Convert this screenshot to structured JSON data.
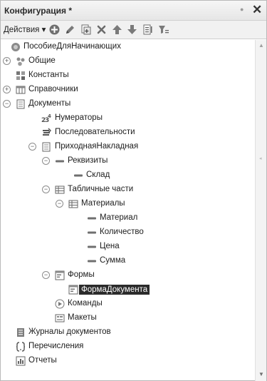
{
  "window": {
    "title": "Конфигурация *"
  },
  "toolbar": {
    "actions_label": "Действия ▾"
  },
  "tree": [
    {
      "id": "root",
      "label": "ПособиеДляНачинающих",
      "icon": "config-root-icon",
      "expander": ""
    },
    {
      "id": "common",
      "label": "Общие",
      "icon": "common-icon",
      "expander": "+"
    },
    {
      "id": "constants",
      "label": "Константы",
      "icon": "constants-icon",
      "expander": ""
    },
    {
      "id": "catalogs",
      "label": "Справочники",
      "icon": "catalogs-icon",
      "expander": "+"
    },
    {
      "id": "documents",
      "label": "Документы",
      "icon": "documents-icon",
      "expander": "−"
    },
    {
      "id": "numerators",
      "label": "Нумераторы",
      "icon": "numerators-icon",
      "expander": ""
    },
    {
      "id": "sequences",
      "label": "Последовательности",
      "icon": "sequences-icon",
      "expander": ""
    },
    {
      "id": "receipt",
      "label": "ПриходнаяНакладная",
      "icon": "document-icon",
      "expander": "−"
    },
    {
      "id": "requisites",
      "label": "Реквизиты",
      "icon": "attributes-icon",
      "expander": "−"
    },
    {
      "id": "warehouse",
      "label": "Склад",
      "icon": "attribute-icon",
      "expander": ""
    },
    {
      "id": "tabular",
      "label": "Табличные части",
      "icon": "tabular-section-icon",
      "expander": "−"
    },
    {
      "id": "materials",
      "label": "Материалы",
      "icon": "tabular-section-icon",
      "expander": "−"
    },
    {
      "id": "material",
      "label": "Материал",
      "icon": "attribute-icon",
      "expander": ""
    },
    {
      "id": "quantity",
      "label": "Количество",
      "icon": "attribute-icon",
      "expander": ""
    },
    {
      "id": "price",
      "label": "Цена",
      "icon": "attribute-icon",
      "expander": ""
    },
    {
      "id": "sum",
      "label": "Сумма",
      "icon": "attribute-icon",
      "expander": ""
    },
    {
      "id": "forms",
      "label": "Формы",
      "icon": "forms-icon",
      "expander": "−"
    },
    {
      "id": "doc_form",
      "label": "ФормаДокумента",
      "icon": "form-icon",
      "expander": "",
      "selected": true
    },
    {
      "id": "commands",
      "label": "Команды",
      "icon": "commands-icon",
      "expander": ""
    },
    {
      "id": "layouts",
      "label": "Макеты",
      "icon": "layouts-icon",
      "expander": ""
    },
    {
      "id": "journals",
      "label": "Журналы документов",
      "icon": "journals-icon",
      "expander": ""
    },
    {
      "id": "enums",
      "label": "Перечисления",
      "icon": "enums-icon",
      "expander": ""
    },
    {
      "id": "reports",
      "label": "Отчеты",
      "icon": "reports-icon",
      "expander": ""
    }
  ]
}
